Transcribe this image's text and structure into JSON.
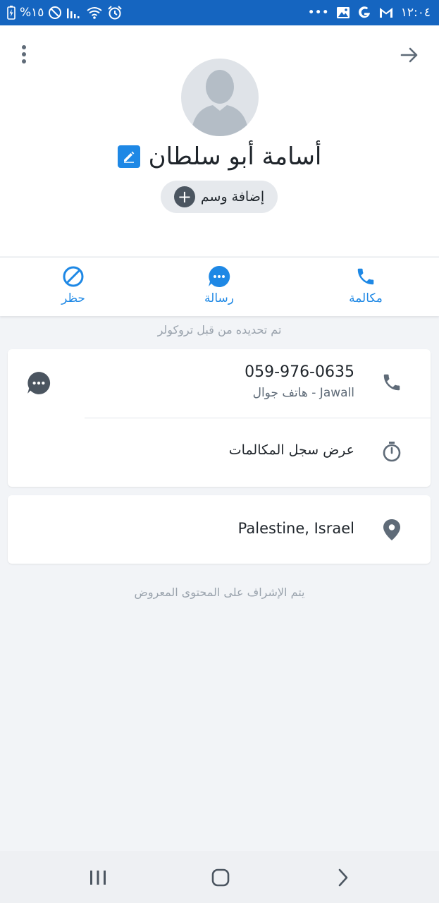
{
  "status_bar": {
    "battery_text": "%١٥",
    "time": "١٢:٠٤",
    "overflow": "•••",
    "left_icons": [
      "charging-battery-icon",
      "do-not-disturb-icon",
      "signal-icon",
      "wifi-icon",
      "alarm-icon"
    ],
    "right_icons": [
      "gallery-icon",
      "google-icon",
      "gmail-icon"
    ]
  },
  "header": {
    "contact_name": "أسامة أبو سلطان",
    "add_tag_label": "إضافة وسم"
  },
  "actions": {
    "call_label": "مكالمة",
    "message_label": "رسالة",
    "block_label": "حظر"
  },
  "verified_text": "تم تحديده من قبل تروكولر",
  "phone_card": {
    "number": "059-976-0635",
    "type": "هاتف جوال - Jawall",
    "history_label": "عرض سجل المكالمات"
  },
  "location_card": {
    "location": "Palestine, Israel"
  },
  "moderation_text": "يتم الإشراف على المحتوى المعروض",
  "colors": {
    "accent": "#1e88e5",
    "status_bar": "#1565c0",
    "icon_gray": "#5f6b78",
    "background": "#f2f4f7"
  }
}
